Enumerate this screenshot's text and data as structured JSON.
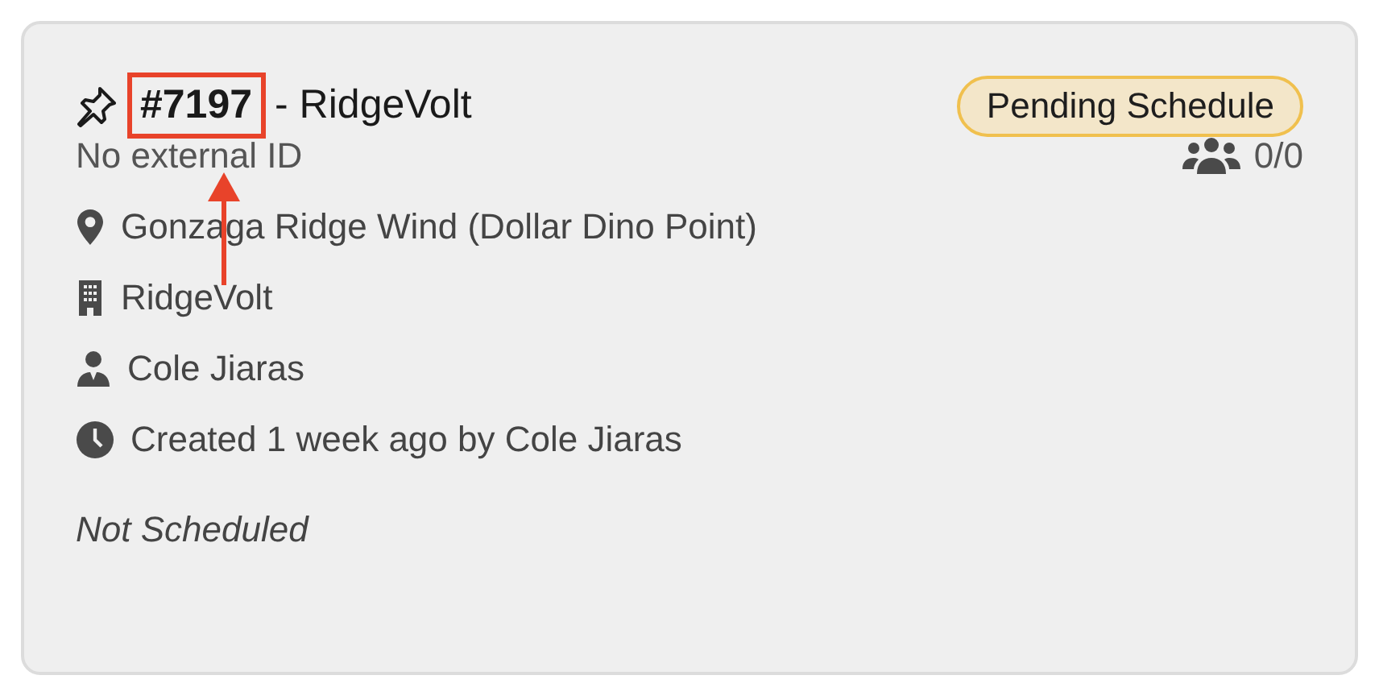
{
  "job": {
    "number": "#7197",
    "number_highlighted": true,
    "separator": "- RidgeVolt",
    "status": "Pending Schedule",
    "external_id": "No external ID",
    "crew_count": "0/0"
  },
  "details": [
    {
      "kind": "location",
      "text": "Gonzaga Ridge Wind (Dollar Dino Point)"
    },
    {
      "kind": "company",
      "text": "RidgeVolt"
    },
    {
      "kind": "person",
      "text": "Cole Jiaras"
    },
    {
      "kind": "created",
      "text": "Created 1 week ago by Cole Jiaras"
    }
  ],
  "schedule": "Not Scheduled"
}
